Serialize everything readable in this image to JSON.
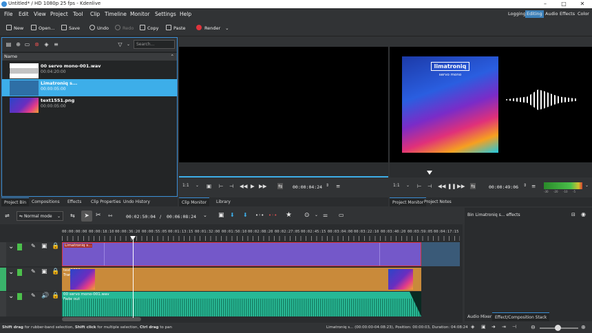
{
  "window": {
    "title": "Untitled* / HD 1080p 25 fps - Kdenlive",
    "minimize": "–",
    "maximize": "□",
    "close": "✕"
  },
  "menu": [
    "File",
    "Edit",
    "View",
    "Project",
    "Tool",
    "Clip",
    "Timeline",
    "Monitor",
    "Settings",
    "Help"
  ],
  "layouts": {
    "items": [
      "Logging",
      "Editing",
      "Audio",
      "Effects",
      "Color"
    ],
    "active": "Editing"
  },
  "toolbar": {
    "new": "New",
    "open": "Open...",
    "save": "Save",
    "undo": "Undo",
    "redo": "Redo",
    "copy": "Copy",
    "paste": "Paste",
    "render": "Render"
  },
  "bin": {
    "search_placeholder": "Search...",
    "column": "Name",
    "items": [
      {
        "name": "00 servo mono-001.wav",
        "duration": "00:04:20:00"
      },
      {
        "name": "Limatroniq s...",
        "duration": "00:00:05:00"
      },
      {
        "name": "text1551.png",
        "duration": "00:00:05:00"
      }
    ],
    "tabs": [
      "Project Bin",
      "Compositions",
      "Effects",
      "Clip Properties",
      "Undo History"
    ]
  },
  "clip_monitor": {
    "zoom": "1:1",
    "timecode": "00:00:04:24",
    "tabs": [
      "Clip Monitor",
      "Library"
    ]
  },
  "project_monitor": {
    "zoom": "1:1",
    "timecode": "00:00:49:06",
    "art_title": "limatroniq",
    "art_subtitle": "servo mono",
    "meter_labels": [
      "-30",
      "-20",
      "-10",
      "-5"
    ],
    "tabs": [
      "Project Monitor",
      "Project Notes"
    ]
  },
  "timeline": {
    "mode": "Normal mode",
    "position": "00:02:50:04",
    "duration": "00:06:08:24",
    "ruler": [
      "00:00:00:00",
      "00:00:18:10",
      "00:00:36:20",
      "00:00:55:05",
      "00:01:13:15",
      "00:01:32:00",
      "00:01:50:10",
      "00:02:08:20",
      "00:02:27:05",
      "00:02:45:15",
      "00:03:04:00",
      "00:03:22:10",
      "00:03:40:20",
      "00:03:59:05",
      "00:04:17:15"
    ],
    "clips": {
      "v2": "Limatroniq s...",
      "v1": "text1551.png",
      "v1_effect": "Transform",
      "a1": "00 servo mono-001.wav",
      "a1_effect": "Fade out"
    }
  },
  "effects_panel": {
    "title": "Bin Limatroniq s... effects",
    "tabs": [
      "Audio Mixer",
      "Effect/Composition Stack"
    ]
  },
  "status": {
    "hint_parts": [
      {
        "text": "Shift drag",
        "bold": true
      },
      {
        "text": " for rubber-band selection, ",
        "bold": false
      },
      {
        "text": "Shift click",
        "bold": true
      },
      {
        "text": " for multiple selection, ",
        "bold": false
      },
      {
        "text": "Ctrl drag",
        "bold": true
      },
      {
        "text": " to pan",
        "bold": false
      }
    ],
    "info": "Limatroniq s... (00:00:00-04:08:23), Position: 00:00:03, Duration: 04:08:24"
  },
  "colors": {
    "accent": "#3daee9",
    "v2_clip": "#7458c9",
    "v1_clip": "#c98a3a",
    "audio_clip": "#26b896",
    "selection_border": "#e0343c"
  }
}
